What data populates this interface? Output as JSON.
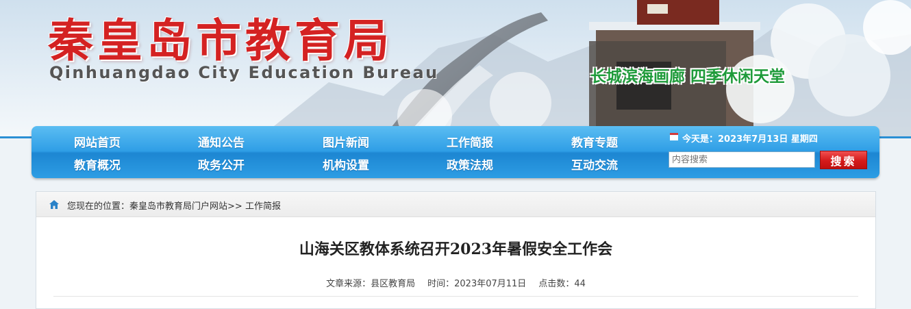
{
  "banner": {
    "title_cn": "秦皇岛市教育局",
    "title_en": "Qinhuangdao City Education Bureau",
    "slogan": "长城滨海画廊 四季休闲天堂",
    "title_color": "#d42222",
    "slogan_color": "#1e9b3a"
  },
  "nav": {
    "row1": [
      "网站首页",
      "通知公告",
      "图片新闻",
      "工作简报",
      "教育专题"
    ],
    "row2": [
      "教育概况",
      "政务公开",
      "机构设置",
      "政策法规",
      "互动交流"
    ],
    "bar_color": "#2f9ee6"
  },
  "header_tools": {
    "today_label": "今天是：2023年7月13日 星期四",
    "search_placeholder": "内容搜索",
    "search_button": "搜索",
    "search_button_color": "#d41a1a"
  },
  "breadcrumb": {
    "prefix": "您现在的位置：",
    "items": [
      "秦皇岛市教育局门户网站",
      "工作简报"
    ],
    "separator": ">>"
  },
  "article": {
    "title": "山海关区教体系统召开2023年暑假安全工作会",
    "source_label": "文章来源：县区教育局",
    "time_label": "时间：2023年07月11日",
    "clicks_label": "点击数：44"
  }
}
